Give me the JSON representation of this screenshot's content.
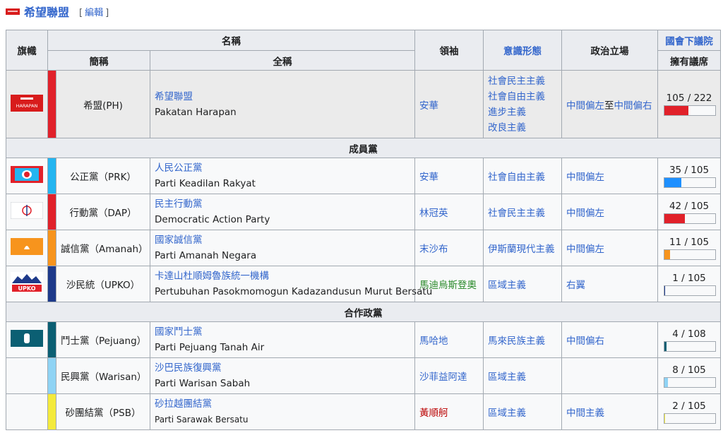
{
  "heading": {
    "title": "希望聯盟",
    "edit_open": "[",
    "edit_label": "編輯",
    "edit_close": "]"
  },
  "headers": {
    "flag": "旗幟",
    "name": "名稱",
    "abbr": "簡稱",
    "full": "全稱",
    "leader": "領袖",
    "ideology": "意識形態",
    "position": "政治立場",
    "parliament": "國會下議院",
    "seats": "擁有議席"
  },
  "coalition": {
    "logo_text": "HARAPAN",
    "abbr": "希盟(PH)",
    "full_link": "希望聯盟",
    "full_en": "Pakatan Harapan",
    "leader": "安華",
    "ideology": [
      "社會民主主義",
      "社會自由主義",
      "進步主義",
      "改良主義"
    ],
    "position_left": "中間偏左",
    "position_join": "至",
    "position_right": "中間偏右",
    "seats_text": "105 / 222",
    "seats_fraction": 0.473,
    "color": "#e1212a"
  },
  "sections": {
    "members": "成員黨",
    "cooperation": "合作政黨"
  },
  "members": [
    {
      "abbr": "公正黨（PRK）",
      "full_link": "人民公正黨",
      "full_en": "Parti Keadilan Rakyat",
      "leader": "安華",
      "ideology": "社會自由主義",
      "position": "中間偏左",
      "seats_text": "35 / 105",
      "seats_fraction": 0.333,
      "color": "#24b5f0",
      "fill": "#1e90ff"
    },
    {
      "abbr": "行動黨（DAP）",
      "full_link": "民主行動黨",
      "full_en": "Democratic Action Party",
      "leader": "林冠英",
      "ideology": "社會民主主義",
      "position": "中間偏左",
      "seats_text": "42 / 105",
      "seats_fraction": 0.4,
      "color": "#e1212a",
      "fill": "#e1212a"
    },
    {
      "abbr": "誠信黨（Amanah）",
      "full_link": "國家誠信黨",
      "full_en": "Parti Amanah Negara",
      "leader": "末沙布",
      "ideology": "伊斯蘭現代主義",
      "position": "中間偏左",
      "seats_text": "11 / 105",
      "seats_fraction": 0.105,
      "color": "#f7941d",
      "fill": "#f7941d"
    },
    {
      "abbr": "沙民統（UPKO）",
      "full_link": "卡達山杜順姆魯族統一機構",
      "full_en": "Pertubuhan Pasokmomogun Kadazandusun Murut Bersatu",
      "leader": "馬迪烏斯登奧",
      "ideology": "區域主義",
      "position": "右翼",
      "seats_text": "1 / 105",
      "seats_fraction": 0.0095,
      "color": "#1e3a8a",
      "fill": "#1e3a8a"
    }
  ],
  "cooperation": [
    {
      "abbr": "鬥士黨（Pejuang）",
      "full_link": "國家鬥士黨",
      "full_en": "Parti Pejuang Tanah Air",
      "leader": "馬哈地",
      "ideology": "馬來民族主義",
      "position": "中間偏右",
      "seats_text": "4 / 108",
      "seats_fraction": 0.037,
      "color": "#0b5f73",
      "fill": "#0b5f73"
    },
    {
      "abbr": "民興黨（Warisan）",
      "full_link": "沙巴民族復興黨",
      "full_en": "Parti Warisan Sabah",
      "leader": "沙菲益阿達",
      "ideology": "區域主義",
      "position": "",
      "seats_text": "8 / 105",
      "seats_fraction": 0.076,
      "color": "#8fd3f4",
      "fill": "#8fd3f4"
    },
    {
      "abbr": "砂團結黨（PSB）",
      "full_link": "砂拉越團結黨",
      "full_en": "Parti Sarawak Bersatu",
      "leader": "黃順舸",
      "ideology": "區域主義",
      "position": "中間主義",
      "seats_text": "2 / 105",
      "seats_fraction": 0.019,
      "color": "#f4ea3c",
      "fill": "#f4ea3c"
    }
  ]
}
